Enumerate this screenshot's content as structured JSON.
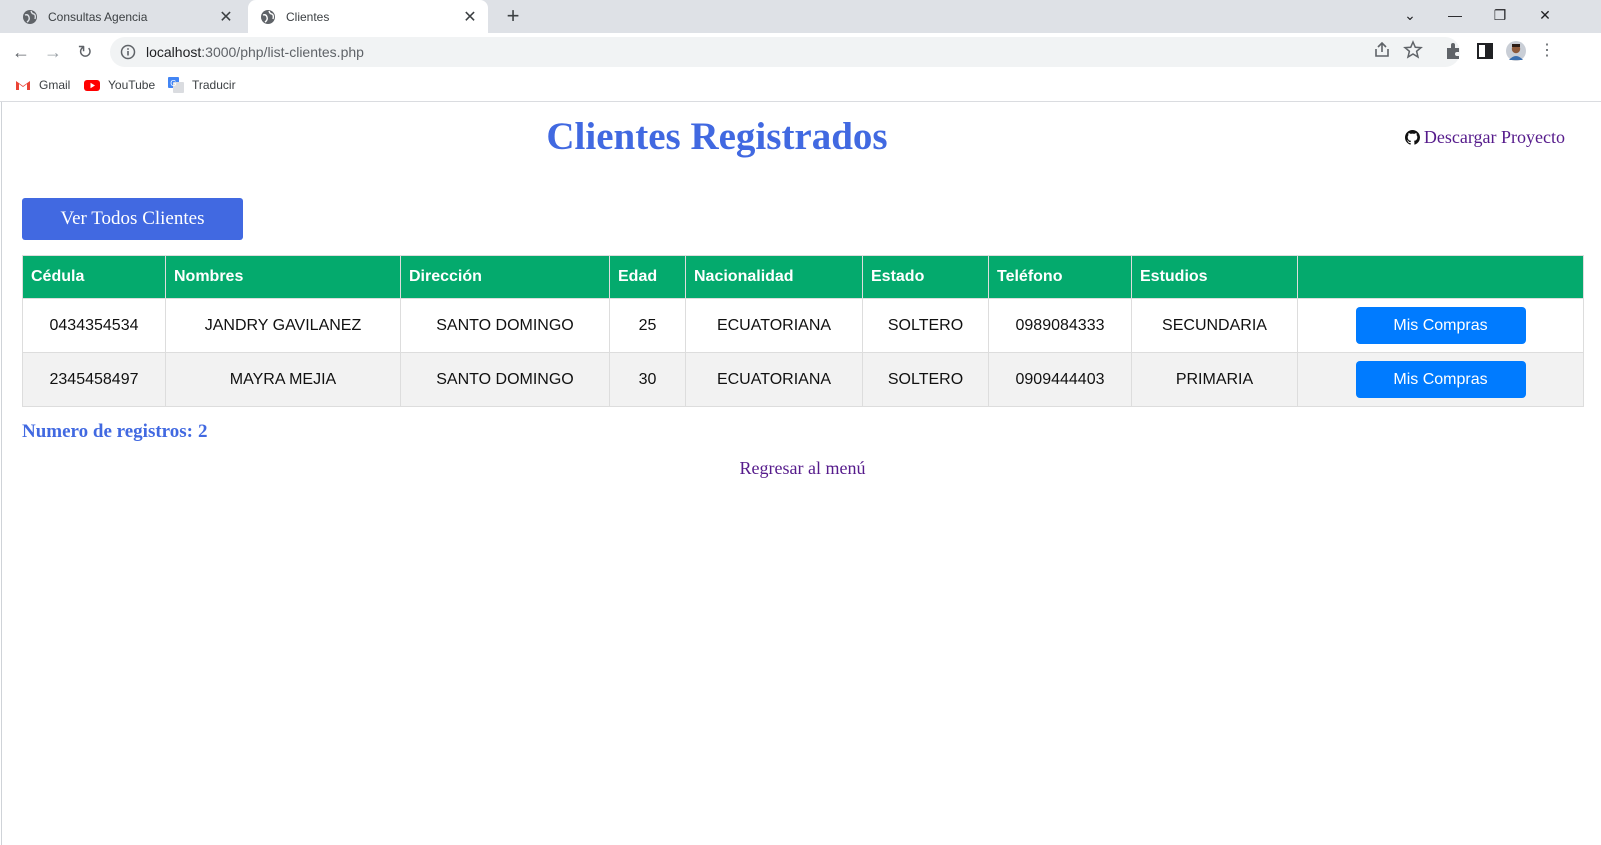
{
  "browser": {
    "tabs": [
      {
        "title": "Consultas Agencia",
        "active": false
      },
      {
        "title": "Clientes",
        "active": true
      }
    ],
    "url_host": "localhost",
    "url_rest": ":3000/php/list-clientes.php",
    "bookmarks": [
      {
        "label": "Gmail",
        "icon": "gmail-icon"
      },
      {
        "label": "YouTube",
        "icon": "youtube-icon"
      },
      {
        "label": "Traducir",
        "icon": "translate-icon"
      }
    ]
  },
  "page": {
    "title": "Clientes Registrados",
    "download_link": "Descargar Proyecto",
    "view_all_button": "Ver Todos Clientes",
    "table": {
      "columns": [
        "Cédula",
        "Nombres",
        "Dirección",
        "Edad",
        "Nacionalidad",
        "Estado",
        "Teléfono",
        "Estudios",
        ""
      ],
      "rows": [
        {
          "cedula": "0434354534",
          "nombres": "JANDRY GAVILANEZ",
          "direccion": "SANTO DOMINGO",
          "edad": "25",
          "nacionalidad": "ECUATORIANA",
          "estado": "SOLTERO",
          "telefono": "0989084333",
          "estudios": "SECUNDARIA",
          "action": "Mis Compras"
        },
        {
          "cedula": "2345458497",
          "nombres": "MAYRA MEJIA",
          "direccion": "SANTO DOMINGO",
          "edad": "30",
          "nacionalidad": "ECUATORIANA",
          "estado": "SOLTERO",
          "telefono": "0909444403",
          "estudios": "PRIMARIA",
          "action": "Mis Compras"
        }
      ]
    },
    "count_label": "Numero de registros:",
    "count_value": "2",
    "back_link": "Regresar al menú"
  },
  "colors": {
    "title": "#4169e1",
    "header_bg": "#04aa6d",
    "action_button": "#007bff",
    "link_visited": "#551a8b"
  }
}
